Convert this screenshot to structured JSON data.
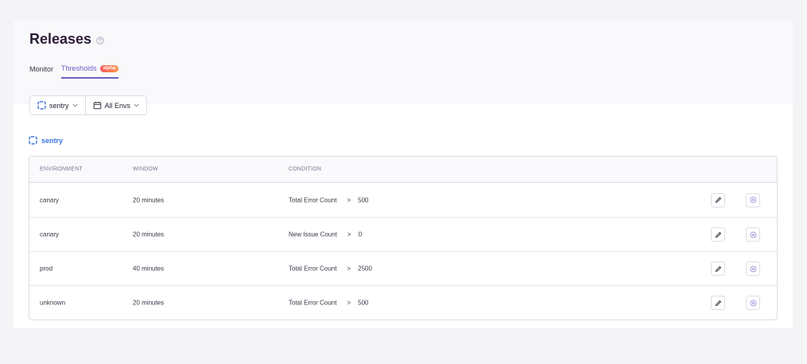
{
  "header": {
    "title": "Releases",
    "help_icon": "question-circle-icon"
  },
  "tabs": [
    {
      "label": "Monitor",
      "active": false
    },
    {
      "label": "Thresholds",
      "active": true,
      "badge": "alpha"
    }
  ],
  "filters": {
    "project": {
      "label": "sentry",
      "icon": "project-icon"
    },
    "environment": {
      "label": "All Envs",
      "icon": "calendar-icon"
    }
  },
  "project_group": {
    "name": "sentry",
    "icon": "project-icon"
  },
  "table": {
    "columns": [
      "ENVIRONMENT",
      "WINDOW",
      "CONDITION"
    ],
    "rows": [
      {
        "environment": "canary",
        "window": "20 minutes",
        "condition": "Total Error Count",
        "operator": ">",
        "value": "500"
      },
      {
        "environment": "canary",
        "window": "20 minutes",
        "condition": "New Issue Count",
        "operator": ">",
        "value": "0"
      },
      {
        "environment": "prod",
        "window": "40 minutes",
        "condition": "Total Error Count",
        "operator": ">",
        "value": "2500"
      },
      {
        "environment": "unknown",
        "window": "20 minutes",
        "condition": "Total Error Count",
        "operator": ">",
        "value": "500"
      }
    ],
    "row_actions": {
      "edit_icon": "pencil-icon",
      "delete_icon": "circle-x-icon"
    }
  },
  "colors": {
    "accent": "#6c5fc7",
    "link": "#3d74db",
    "badge_start": "#f55459",
    "badge_end": "#f69c54"
  }
}
